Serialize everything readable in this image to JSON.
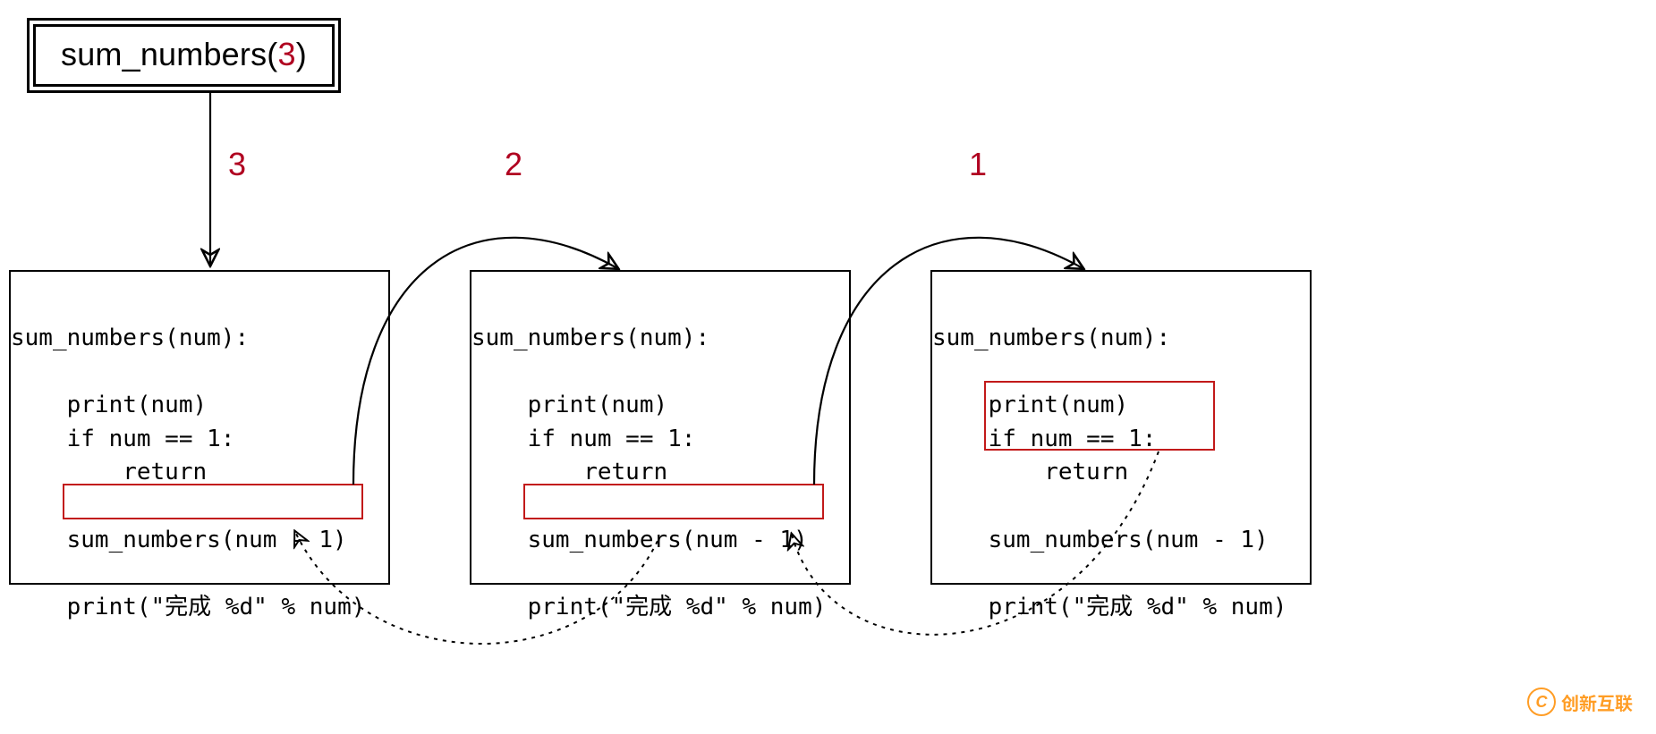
{
  "call_box": {
    "fn": "sum_numbers",
    "arg": "3",
    "open": "(",
    "close": ")"
  },
  "steps": {
    "a": "3",
    "b": "2",
    "c": "1"
  },
  "frame_code": {
    "line_sig": "sum_numbers(num):",
    "line_blank": "",
    "line_print": "    print(num)",
    "line_if": "    if num == 1:",
    "line_return": "        return",
    "line_call": "    sum_numbers(num - 1)",
    "line_callexpr": "sum_numbers(num - 1)",
    "line_print2": "    print(\"完成 %d\" % num)",
    "line_if_raw": "if num == 1:",
    "line_return_ind": "    return"
  },
  "watermark": {
    "icon_letter": "C",
    "text": "创新互联"
  },
  "colors": {
    "accent_red": "#b00020",
    "highlight_border": "#c21a1a",
    "watermark_orange": "#ff8c00"
  }
}
